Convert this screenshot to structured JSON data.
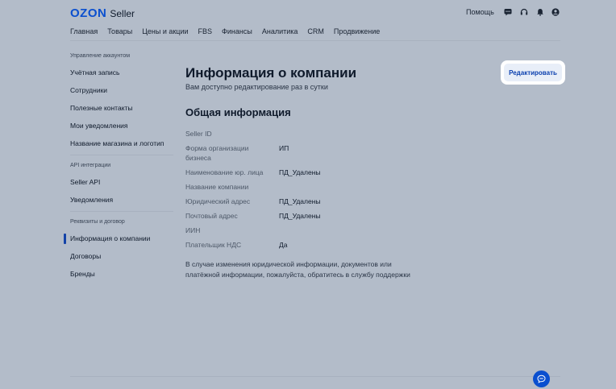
{
  "header": {
    "logo_ozon": "OZON",
    "logo_seller": "Seller",
    "help": "Помощь",
    "icons": [
      "chat-icon",
      "headset-icon",
      "bell-icon",
      "profile-icon"
    ]
  },
  "topnav": [
    "Главная",
    "Товары",
    "Цены и акции",
    "FBS",
    "Финансы",
    "Аналитика",
    "CRM",
    "Продвижение"
  ],
  "sidebar": {
    "section_account": "Управление аккаунтом",
    "account_items": [
      "Учётная запись",
      "Сотрудники",
      "Полезные контакты",
      "Мои уведомления",
      "Название магазина и логотип"
    ],
    "section_api": "API интеграции",
    "api_items": [
      "Seller API",
      "Уведомления"
    ],
    "section_requisites": "Реквизиты и договор",
    "requisites_items": [
      "Информация о компании",
      "Договоры",
      "Бренды"
    ],
    "active_item": "Информация о компании"
  },
  "main": {
    "title": "Информация о компании",
    "subtitle": "Вам доступно редактирование раз в сутки",
    "edit_button": "Редактировать",
    "section_title": "Общая информация",
    "rows": [
      {
        "label": "Seller ID",
        "value": ""
      },
      {
        "label": "Форма организации бизнеса",
        "value": "ИП"
      },
      {
        "label": "Наименование юр. лица",
        "value": "ПД_Удалены"
      },
      {
        "label": "Название компании",
        "value": ""
      },
      {
        "label": "Юридический адрес",
        "value": "ПД_Удалены"
      },
      {
        "label": "Почтовый адрес",
        "value": "ПД_Удалены"
      },
      {
        "label": "ИИН",
        "value": ""
      },
      {
        "label": "Плательщик НДС",
        "value": "Да"
      }
    ],
    "note": "В случае изменения юридической информации, документов или платёжной информации, пожалуйста, обратитесь в службу поддержки"
  },
  "colors": {
    "overlay_background": "#b3bcc9",
    "brand": "#0a4fcf",
    "active_indicator": "#1342a8"
  }
}
